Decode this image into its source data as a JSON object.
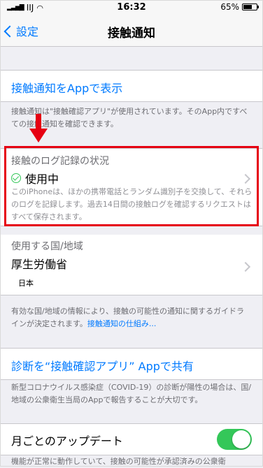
{
  "status": {
    "carrier": "IIJ",
    "time": "16:32",
    "battery": "65%"
  },
  "nav": {
    "back_label": "設定",
    "title": "接触通知"
  },
  "show_in_app": {
    "label": "接触通知をAppで表示"
  },
  "info_footer": "接触通知は\"接触確認アプリ\"が使用されています。そのApp内ですべての接触通知を確認できます。",
  "log_status": {
    "header": "接触のログ記録の状況",
    "state": "使用中",
    "description": "このiPhoneは、ほかの携帯電話とランダム識別子を交換して、それらのログを記録します。過去14日間の接触ログを確認するリクエストはすべて保存されます。"
  },
  "region": {
    "header": "使用する国/地域",
    "value": "厚生労働省",
    "country": "日本"
  },
  "region_footer": {
    "text": "有効な国/地域の情報により、接触の可能性の通知に関するガイドラインが決定されます。",
    "link": "接触通知の仕組み..."
  },
  "share": {
    "label": "診断を“接触確認アプリ” Appで共有"
  },
  "share_footer": "新型コロナウイルス感染症（COVID-19）の診断が陽性の場合は、国/地域の公衆衛生当局のAppで報告することが大切です。",
  "monthly": {
    "label": "月ごとのアップデート",
    "enabled": true
  },
  "monthly_footer": "機能が正常に動作していて、接触の可能性が承認済みの公衆衛"
}
